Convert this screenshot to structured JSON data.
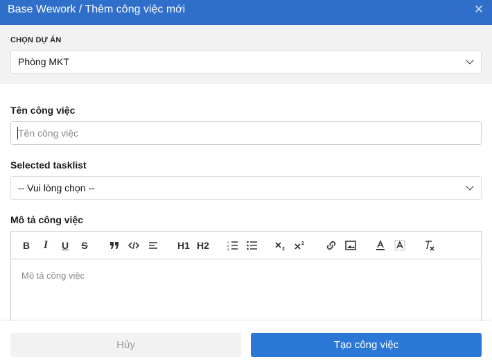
{
  "header": {
    "title": "Base Wework / Thêm công việc mới",
    "close_icon": "close-icon"
  },
  "project": {
    "label": "CHỌN DỰ ÁN",
    "value": "Phòng MKT"
  },
  "task_name": {
    "label": "Tên công việc",
    "placeholder": "Tên công việc"
  },
  "tasklist": {
    "label": "Selected tasklist",
    "value": "-- Vui lòng chọn --"
  },
  "description": {
    "label": "Mô tả công việc",
    "placeholder": "Mô tả công việc",
    "toolbar": {
      "bold": "B",
      "italic": "I",
      "underline": "U",
      "strike": "S",
      "h1": "H1",
      "h2": "H2"
    }
  },
  "footer": {
    "cancel_label": "Hủy",
    "create_label": "Tạo công việc"
  },
  "colors": {
    "header_bg": "#2f6fc9",
    "primary_button": "#2a77d6"
  }
}
